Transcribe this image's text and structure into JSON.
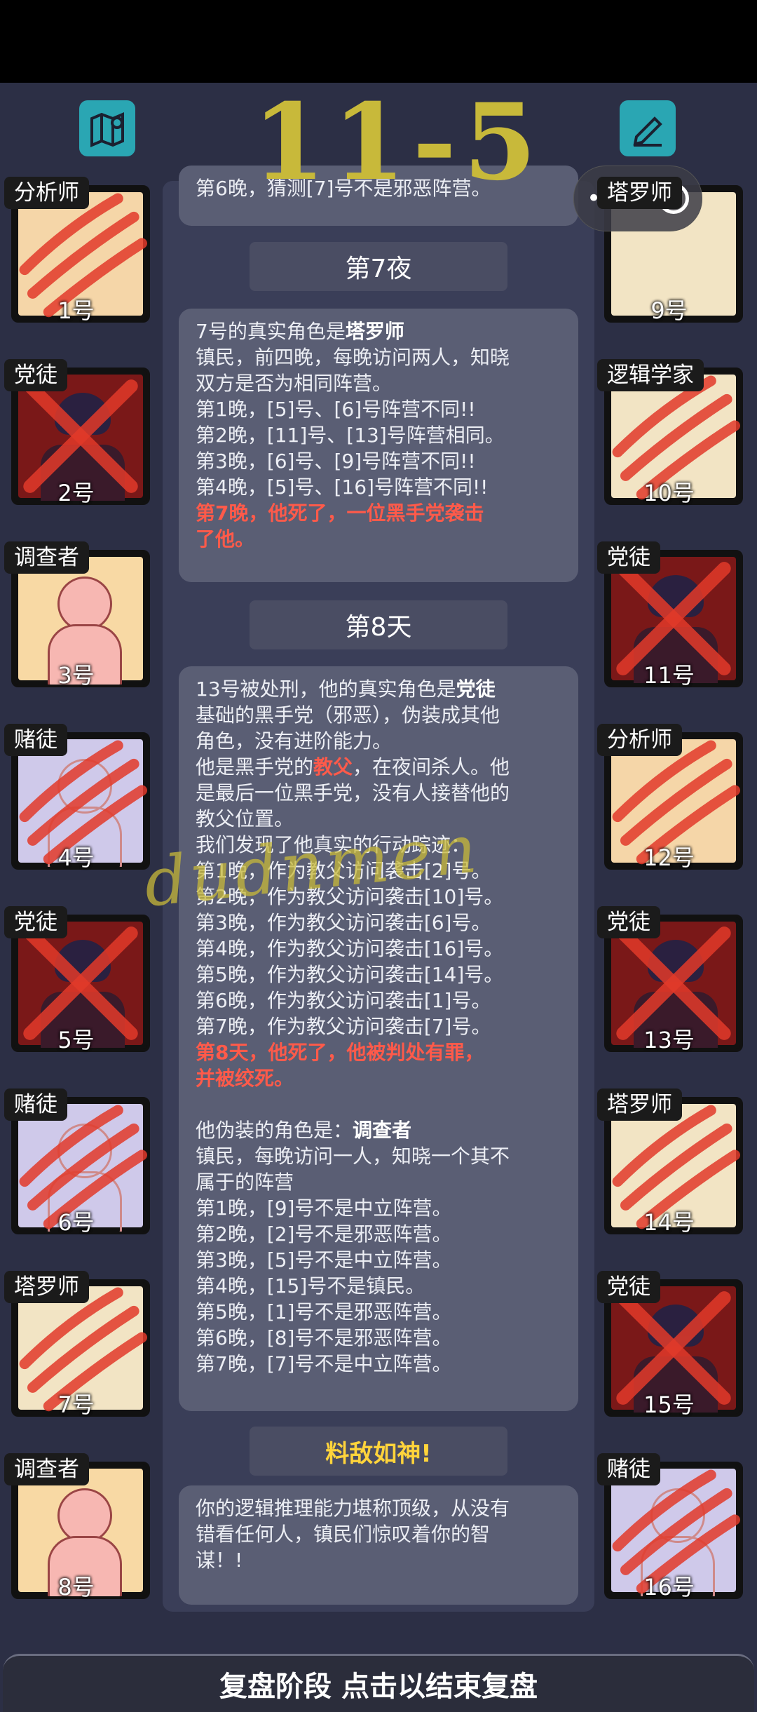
{
  "overlay_text": "11-5",
  "signature_text": "dudnmen",
  "miniprogram": {
    "dots": "•••"
  },
  "log": {
    "card0": {
      "text": "第6晚，猜测[7]号不是邪恶阵营。"
    },
    "night7": {
      "label": "第7夜"
    },
    "card1": {
      "prefix": "7号的真实角色是",
      "role": "塔罗师",
      "lines": [
        "镇民，前四晚，每晚访问两人，知晓",
        "双方是否为相同阵营。",
        "第1晚，[5]号、[6]号阵营不同!!",
        "第2晚，[11]号、[13]号阵营相同。",
        "第3晚，[6]号、[9]号阵营不同!!",
        "第4晚，[5]号、[16]号阵营不同!!"
      ],
      "death": [
        "第7晚，他死了，一位黑手党袭击",
        "了他。"
      ]
    },
    "day8": {
      "label": "第8天"
    },
    "card2": {
      "prefix": "13号被处刑，他的真实角色是",
      "role": "党徒",
      "line1": "基础的黑手党（邪恶），伪装成其他",
      "line2": "角色，没有进阶能力。",
      "godfather_pre": "他是黑手党的",
      "godfather": "教父",
      "godfather_post": "，在夜间杀人。他",
      "line4": "是最后一位黑手党，没有人接替他的",
      "line5": "教父位置。",
      "line6": "我们发现了他真实的行动踪迹：",
      "actions": [
        "第1晚，作为教父访问袭击[2]号。",
        "第2晚，作为教父访问袭击[10]号。",
        "第3晚，作为教父访问袭击[6]号。",
        "第4晚，作为教父访问袭击[16]号。",
        "第5晚，作为教父访问袭击[14]号。",
        "第6晚，作为教父访问袭击[1]号。",
        "第7晚，作为教父访问袭击[7]号。"
      ],
      "death": [
        "第8天，他死了，他被判处有罪，",
        "并被绞死。"
      ],
      "disguise_prefix": "他伪装的角色是：",
      "disguise_role": "调查者",
      "disguise_lines": [
        "镇民，每晚访问一人，知晓一个其不",
        "属于的阵营"
      ],
      "checks": [
        "第1晚，[9]号不是中立阵营。",
        "第2晚，[2]号不是邪恶阵营。",
        "第3晚，[5]号不是中立阵营。",
        "第4晚，[15]号不是镇民。",
        "第5晚，[1]号不是邪恶阵营。",
        "第6晚，[8]号不是邪恶阵营。",
        "第7晚，[7]号不是中立阵营。"
      ]
    },
    "achievement": {
      "label": "料敌如神!"
    },
    "card3": {
      "lines": [
        "你的逻辑推理能力堪称顶级，从没有",
        "错看任何人，镇民们惊叹着你的智",
        "谋！!"
      ]
    }
  },
  "players_left": [
    {
      "role": "分析师",
      "num": "1号",
      "dead": true,
      "style": "peach",
      "kind": "art"
    },
    {
      "role": "党徒",
      "num": "2号",
      "dead": true,
      "style": "darkred",
      "kind": "mafia"
    },
    {
      "role": "调查者",
      "num": "3号",
      "dead": false,
      "style": "skin",
      "kind": "investigator"
    },
    {
      "role": "赌徒",
      "num": "4号",
      "dead": true,
      "style": "lilac",
      "kind": "gambler"
    },
    {
      "role": "党徒",
      "num": "5号",
      "dead": true,
      "style": "darkred",
      "kind": "mafia"
    },
    {
      "role": "赌徒",
      "num": "6号",
      "dead": true,
      "style": "lilac",
      "kind": "gambler"
    },
    {
      "role": "塔罗师",
      "num": "7号",
      "dead": true,
      "style": "pale",
      "kind": "art"
    },
    {
      "role": "调查者",
      "num": "8号",
      "dead": false,
      "style": "skin",
      "kind": "investigator"
    }
  ],
  "players_right": [
    {
      "role": "塔罗师",
      "num": "9号",
      "dead": false,
      "style": "pale",
      "kind": "art"
    },
    {
      "role": "逻辑学家",
      "num": "10号",
      "dead": true,
      "style": "pale",
      "kind": "art"
    },
    {
      "role": "党徒",
      "num": "11号",
      "dead": true,
      "style": "darkred",
      "kind": "mafia"
    },
    {
      "role": "分析师",
      "num": "12号",
      "dead": true,
      "style": "peach",
      "kind": "art"
    },
    {
      "role": "党徒",
      "num": "13号",
      "dead": true,
      "style": "darkred",
      "kind": "mafia"
    },
    {
      "role": "塔罗师",
      "num": "14号",
      "dead": true,
      "style": "pale",
      "kind": "art"
    },
    {
      "role": "党徒",
      "num": "15号",
      "dead": true,
      "style": "darkred",
      "kind": "mafia"
    },
    {
      "role": "赌徒",
      "num": "16号",
      "dead": true,
      "style": "lilac",
      "kind": "gambler"
    }
  ],
  "bottom_button": {
    "label": "复盘阶段 点击以结束复盘"
  },
  "colors": {
    "background": "#2c2f45",
    "card": "#5a5e74",
    "death_text": "#ff5a4a",
    "achievement": "#ffd43b",
    "scratch": "#e23a2a"
  }
}
